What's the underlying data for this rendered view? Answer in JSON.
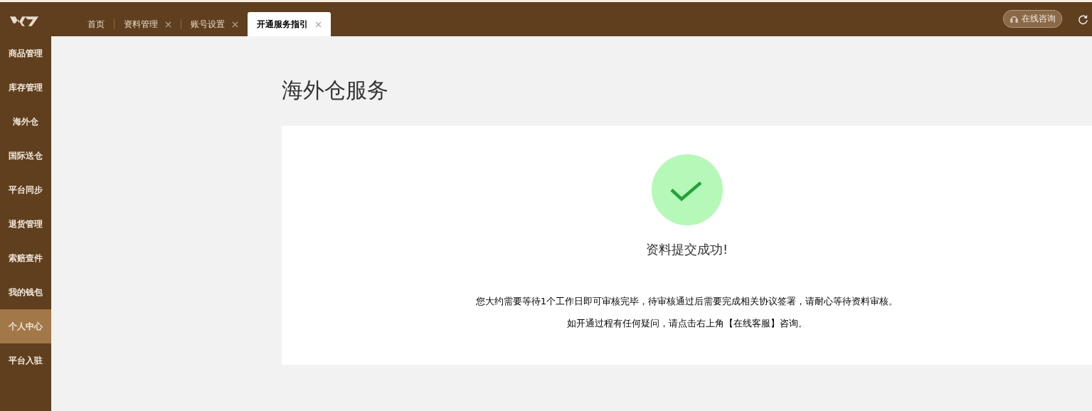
{
  "tabs": [
    {
      "label": "首页",
      "closable": false,
      "selected": false
    },
    {
      "label": "资料管理",
      "closable": true,
      "selected": false
    },
    {
      "label": "账号设置",
      "closable": true,
      "selected": false
    },
    {
      "label": "开通服务指引",
      "closable": true,
      "selected": true
    }
  ],
  "consult_button": "在线咨询",
  "sidebar": {
    "items": [
      {
        "label": "商品管理",
        "selected": false
      },
      {
        "label": "库存管理",
        "selected": false
      },
      {
        "label": "海外仓",
        "selected": false
      },
      {
        "label": "国际送仓",
        "selected": false
      },
      {
        "label": "平台同步",
        "selected": false
      },
      {
        "label": "退货管理",
        "selected": false
      },
      {
        "label": "索赔查件",
        "selected": false
      },
      {
        "label": "我的钱包",
        "selected": false
      },
      {
        "label": "个人中心",
        "selected": true
      },
      {
        "label": "平台入驻",
        "selected": false
      }
    ]
  },
  "page_title": "海外仓服务",
  "result": {
    "title": "资料提交成功!",
    "messages": [
      "您大约需要等待1个工作日即可审核完毕，待审核通过后需要完成相关协议签署，请耐心等待资料审核。",
      "如开通过程有任何疑问，请点击右上角【在线客服】咨询。"
    ]
  }
}
